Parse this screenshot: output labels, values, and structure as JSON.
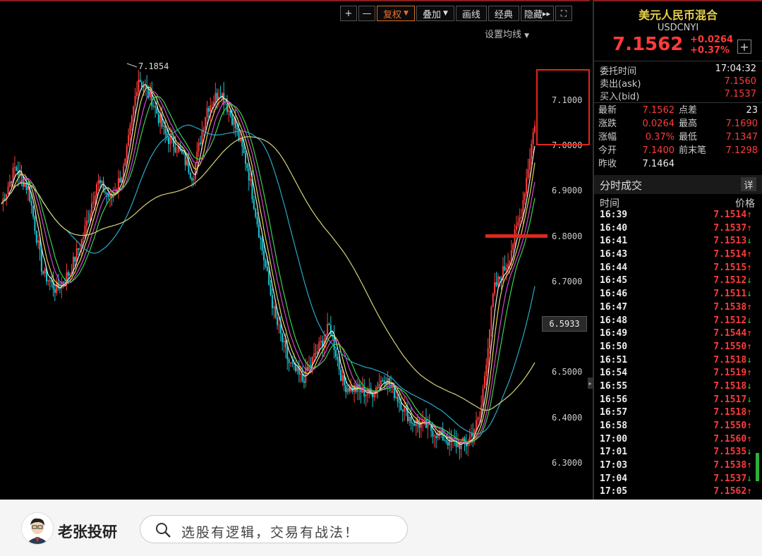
{
  "toolbar": {
    "zoom_in": "+",
    "zoom_out": "—",
    "adjust": "复权",
    "overlay": "叠加",
    "draw": "画线",
    "classic": "经典",
    "hide": "隐藏",
    "hide_arrows": "▸▸",
    "fullscreen": "⛶"
  },
  "chart": {
    "ma_setting": "设置均线",
    "high_label": "7.1854",
    "current_price_tag": "6.5933",
    "y_ticks": [
      "7.1000",
      "7.0000",
      "6.9000",
      "6.8000",
      "6.7000",
      "6.5000",
      "6.4000",
      "6.3000"
    ],
    "colors": {
      "up": "#ff3b3b",
      "down": "#19c6d1",
      "ma_white": "#e8e8e8",
      "ma_yellow": "#e6d64a",
      "ma_magenta": "#d845d8",
      "ma_green": "#3ad44a",
      "ma_cyan": "#2aa8c8",
      "ma_khaki": "#d8d27a",
      "annotation": "#e1261c"
    }
  },
  "chart_data": {
    "type": "line",
    "title": "",
    "ylim": [
      6.25,
      7.2
    ],
    "y_ticks": [
      7.1,
      7.0,
      6.9,
      6.8,
      6.7,
      6.5,
      6.4,
      6.3
    ],
    "series": [
      {
        "values": [
          6.87,
          6.95,
          6.9,
          6.72,
          6.68,
          6.72,
          6.8,
          6.92,
          6.88,
          6.95,
          7.15,
          7.1,
          7.02,
          6.99,
          6.93,
          7.08,
          7.12,
          7.05,
          6.95,
          6.78,
          6.62,
          6.52,
          6.48,
          6.54,
          6.6,
          6.47,
          6.46,
          6.45,
          6.49,
          6.44,
          6.39,
          6.38,
          6.36,
          6.34,
          6.34,
          6.4,
          6.68,
          6.74,
          6.85,
          7.05
        ]
      }
    ]
  },
  "quote": {
    "name": "美元人民币混合",
    "code": "USDCNYI",
    "price": "7.1562",
    "change": "+0.0264",
    "change_pct": "+0.37%",
    "add": "+",
    "order_time_label": "委托时间",
    "order_time": "17:04:32",
    "ask_label": "卖出(ask)",
    "ask": "7.1560",
    "bid_label": "买入(bid)",
    "bid": "7.1537",
    "latest_label": "最新",
    "latest": "7.1562",
    "spread_label": "点差",
    "spread": "23",
    "chg_label": "涨跌",
    "chg": "0.0264",
    "high_label": "最高",
    "high": "7.1690",
    "pct_label": "涨幅",
    "pct": "0.37%",
    "low_label": "最低",
    "low": "7.1347",
    "open_label": "今开",
    "open": "7.1400",
    "last_label": "前末笔",
    "last": "7.1298",
    "prev_label": "昨收",
    "prev": "7.1464"
  },
  "timesales": {
    "title": "分时成交",
    "detail": "详",
    "col_time": "时间",
    "col_price": "价格",
    "rows": [
      {
        "t": "16:39",
        "p": "7.1514",
        "d": "↑",
        "dir": "up"
      },
      {
        "t": "16:40",
        "p": "7.1537",
        "d": "↑",
        "dir": "up"
      },
      {
        "t": "16:41",
        "p": "7.1513",
        "d": "↓",
        "dir": "dn"
      },
      {
        "t": "16:43",
        "p": "7.1514",
        "d": "↑",
        "dir": "up"
      },
      {
        "t": "16:44",
        "p": "7.1515",
        "d": "↑",
        "dir": "up"
      },
      {
        "t": "16:45",
        "p": "7.1512",
        "d": "↓",
        "dir": "dn"
      },
      {
        "t": "16:46",
        "p": "7.1511",
        "d": "↓",
        "dir": "dn"
      },
      {
        "t": "16:47",
        "p": "7.1538",
        "d": "↑",
        "dir": "up"
      },
      {
        "t": "16:48",
        "p": "7.1512",
        "d": "↓",
        "dir": "dn"
      },
      {
        "t": "16:49",
        "p": "7.1544",
        "d": "↑",
        "dir": "up"
      },
      {
        "t": "16:50",
        "p": "7.1550",
        "d": "↑",
        "dir": "up"
      },
      {
        "t": "16:51",
        "p": "7.1518",
        "d": "↓",
        "dir": "dn"
      },
      {
        "t": "16:54",
        "p": "7.1519",
        "d": "↑",
        "dir": "up"
      },
      {
        "t": "16:55",
        "p": "7.1518",
        "d": "↓",
        "dir": "dn"
      },
      {
        "t": "16:56",
        "p": "7.1517",
        "d": "↓",
        "dir": "dn"
      },
      {
        "t": "16:57",
        "p": "7.1518",
        "d": "↑",
        "dir": "up"
      },
      {
        "t": "16:58",
        "p": "7.1550",
        "d": "↑",
        "dir": "up"
      },
      {
        "t": "17:00",
        "p": "7.1560",
        "d": "↑",
        "dir": "up"
      },
      {
        "t": "17:01",
        "p": "7.1535",
        "d": "↓",
        "dir": "dn"
      },
      {
        "t": "17:03",
        "p": "7.1538",
        "d": "↑",
        "dir": "up"
      },
      {
        "t": "17:04",
        "p": "7.1537",
        "d": "↓",
        "dir": "dn"
      },
      {
        "t": "17:05",
        "p": "7.1562",
        "d": "↑",
        "dir": "up"
      }
    ]
  },
  "footer": {
    "brand": "老张投研",
    "search_text": "选股有逻辑，交易有战法！"
  }
}
